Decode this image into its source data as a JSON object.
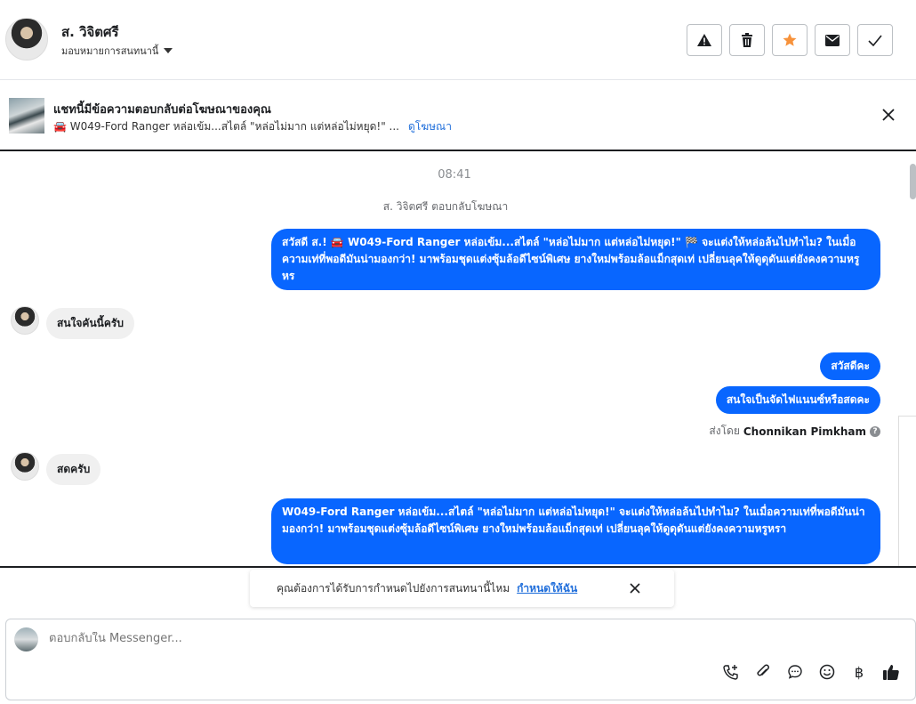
{
  "header": {
    "contact_name": "ส. วิจิตศรี",
    "assign_label": "มอบหมายการสนทนานี้",
    "buttons": [
      "report",
      "delete",
      "star",
      "mark-unread",
      "done"
    ]
  },
  "ad": {
    "title": "แชทนี้มีข้อความตอบกลับต่อโฆษณาของคุณ",
    "summary": "🚘 W049-Ford Ranger หล่อเข้ม...สไตล์ \"หล่อไม่มาก แต่หล่อไม่หยุด!\" ...",
    "link": "ดูโฆษณา"
  },
  "chat": {
    "time": "08:41",
    "system_message": "ส. วิจิตศรี ตอบกลับโฆษณา",
    "msg1": "สวัสดี ส.! 🚘 W049-Ford Ranger หล่อเข้ม...สไตล์ \"หล่อไม่มาก แต่หล่อไม่หยุด!\" 🏁 จะแต่งให้หล่อล้นไปทำไม? ในเมื่อความเท่ที่พอดีมันน่ามองกว่า! มาพร้อมชุดแต่งซุ้มล้อดีไซน์พิเศษ ยางใหม่พร้อมล้อแม็กสุดเท่ เปลี่ยนลุคให้ดูดุดันแต่ยังคงความหรูหร",
    "msg2": "สนใจคันนี้ครับ",
    "msg3": "สวัสดีคะ",
    "msg4": "สนใจเป็นจัดไฟแนนซ์หรือสดคะ",
    "sent_by_prefix": "ส่งโดย",
    "sent_by_name": "Chonnikan Pimkham",
    "msg5": "สดครับ",
    "msg6": "W049-Ford Ranger หล่อเข้ม...สไตล์ \"หล่อไม่มาก แต่หล่อไม่หยุด!\"  จะแต่งให้หล่อล้นไปทำไม? ในเมื่อความเท่ที่พอดีมันน่ามองกว่า! มาพร้อมชุดแต่งซุ้มล้อดีไซน์พิเศษ ยางใหม่พร้อมล้อแม็กสุดเท่ เปลี่ยนลุคให้ดูดุดันแต่ยังคงความหรูหรา"
  },
  "reminder": {
    "text": "คุณต้องการได้รับการกำหนดไปยังการสนทนานี้ไหม",
    "link": "กำหนดให้ฉัน"
  },
  "composer": {
    "placeholder": "ตอบกลับใน Messenger...",
    "currency_symbol": "฿"
  },
  "colors": {
    "accent": "#0866ff",
    "star": "#f7923b",
    "link": "#216fdb"
  }
}
